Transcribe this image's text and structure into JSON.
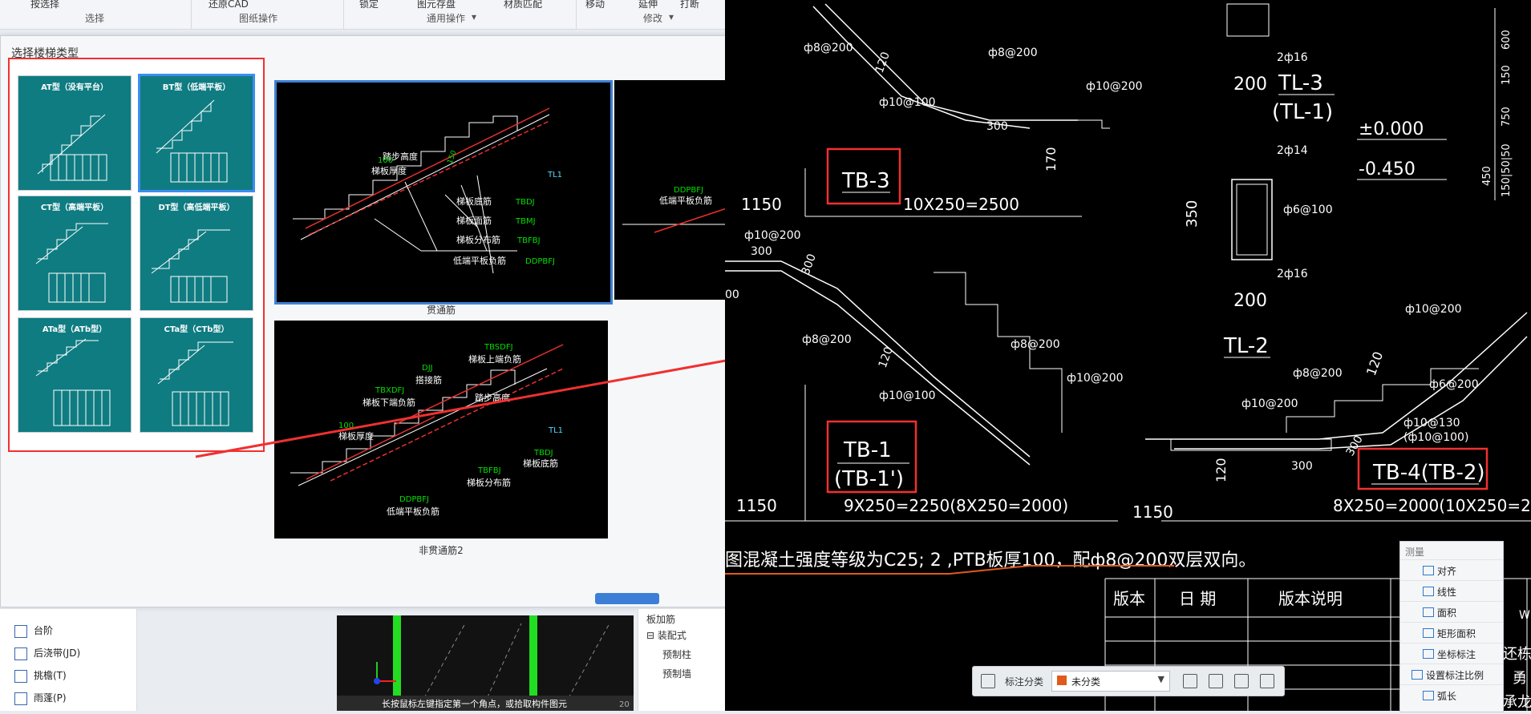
{
  "ribbon": {
    "groups": [
      {
        "name": "选择",
        "items": [
          "按选择"
        ]
      },
      {
        "name": "图纸操作",
        "items": [
          "还原CAD"
        ]
      },
      {
        "name": "通用操作",
        "items": [
          "锁定",
          "图元存盘",
          "材质匹配"
        ]
      },
      {
        "name": "修改",
        "items": [
          "移动",
          "延伸",
          "打断"
        ]
      }
    ]
  },
  "dialog": {
    "title": "选择楼梯类型",
    "stair_types": [
      {
        "label": "AT型（没有平台）"
      },
      {
        "label": "BT型（低端平板）"
      },
      {
        "label": "CT型（高端平板）"
      },
      {
        "label": "DT型（高低端平板）"
      },
      {
        "label": "ATa型（ATb型）"
      },
      {
        "label": "CTa型（CTb型）"
      }
    ],
    "previews": [
      {
        "caption": "贯通筋",
        "labels": {
          "thickness_value": "100",
          "thickness": "梯板厚度",
          "step_height": "踏步高度",
          "step_value": "150",
          "tl": "TL1",
          "bottom_bar": "梯板底筋",
          "bottom_code": "TBDJ",
          "top_bar": "梯板面筋",
          "top_code": "TBMJ",
          "dist_bar": "梯板分布筋",
          "dist_code": "TBFBJ",
          "low_neg": "低端平板负筋",
          "low_neg_code": "DDPBFJ"
        }
      },
      {
        "caption": "非贯通筋2",
        "labels": {
          "upper_code": "TBSDFJ",
          "upper_neg": "梯板上端负筋",
          "lap_code": "DJJ",
          "lap": "搭接筋",
          "lower_code": "TBXDFJ",
          "lower_neg": "梯板下端负筋",
          "step_height": "踏步高度",
          "thickness_value": "100",
          "thickness": "梯板厚度",
          "tl": "TL1",
          "bottom_code": "TBDJ",
          "bottom_bar": "梯板底筋",
          "dist_code": "TBFBJ",
          "dist_bar": "梯板分布筋",
          "low_code": "DDPBFJ",
          "low_neg": "低端平板负筋"
        }
      },
      {
        "caption": "",
        "labels": {
          "code": "DDPBFJ",
          "text": "低端平板负筋"
        }
      }
    ]
  },
  "nav": {
    "items": [
      {
        "label": "台阶"
      },
      {
        "label": "后浇带(JD)"
      },
      {
        "label": "挑檐(T)"
      },
      {
        "label": "雨蓬(P)"
      }
    ]
  },
  "props": {
    "rows": [
      "板加筋",
      "⊟ 装配式",
      "预制柱",
      "预制墙"
    ]
  },
  "bottom_strip": {
    "text": "长按鼠标左键指定第一个角点，或拾取构件图元",
    "num": "20"
  },
  "cad": {
    "labels": {
      "tb3": "TB-3",
      "tb1": "TB-1",
      "tb1p": "(TB-1')",
      "tb4": "TB-4(TB-2)",
      "tl3": "TL-3",
      "tl1": "(TL-1)",
      "tl2": "TL-2",
      "d1": "10X250=2500",
      "d2": "9X250=2250(8X250=2000)",
      "d3": "8X250=2000(10X250=2500)",
      "l1150a": "1150",
      "l1150b": "1150",
      "l1150c": "1150",
      "b8a": "ф8@200",
      "b8b": "ф8@200",
      "b8c": "ф8@200",
      "b8d": "ф8@200",
      "b8e": "ф8@200",
      "b10a": "ф10@100",
      "b10b": "ф10@200",
      "b10c": "ф10@200",
      "b10d": "ф10@100",
      "b10e": "ф10@200",
      "b10f": "ф10@200",
      "b10g": "ф10@200",
      "b10h": "ф10@130",
      "b10i": "(ф10@100)",
      "b6a": "ф6@100",
      "b6b": "ф6@200",
      "s216a": "2ф16",
      "s214": "2ф14",
      "s216b": "2ф16",
      "w200a": "200",
      "w200b": "200",
      "h350": "350",
      "d120a": "120",
      "d120b": "120",
      "d120c": "120",
      "d120d": "120",
      "d170": "170",
      "d300a": "300",
      "d300b": "300",
      "d300c": "300",
      "d300d": "300",
      "d300e": "300",
      "zero": "±0.000",
      "neg": "-0.450",
      "r600": "600",
      "r150": "150",
      "r750": "750",
      "r450": "450",
      "r150x": "150|50|50",
      "n100": "00",
      "note": "图混凝土强度等级为C25; 2 ,PTB板厚100，配ф8@200双层双向。",
      "tbl_ver": "版本",
      "tbl_date": "日 期",
      "tbl_desc": "版本说明",
      "right1": "W",
      "right2": "还栋",
      "right3": "勇",
      "right4": "承龙"
    }
  },
  "measure": {
    "title": "测量",
    "items": [
      "对齐",
      "线性",
      "面积",
      "矩形面积",
      "坐标标注",
      "设置标注比例",
      "弧长"
    ]
  },
  "anno_bar": {
    "label": "标注分类",
    "value": "未分类"
  },
  "colors": {
    "highlight_red": "#f03030",
    "thumb_teal": "#0f7c82",
    "select_blue": "#3d8ef0",
    "cad_text": "#ffffff",
    "orange_line": "#e05a1c"
  }
}
